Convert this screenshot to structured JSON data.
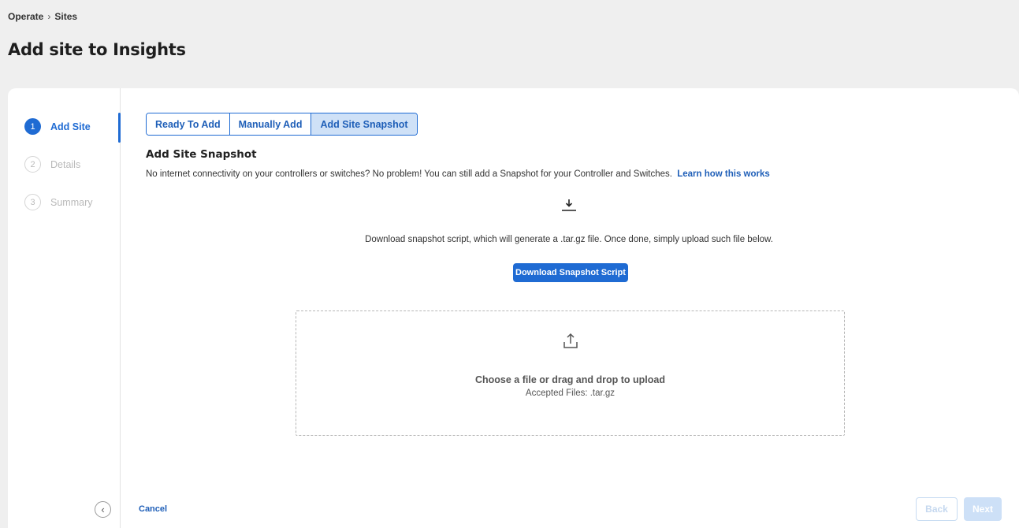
{
  "breadcrumb": {
    "parent": "Operate",
    "separator": "›",
    "current": "Sites"
  },
  "page": {
    "title": "Add site to Insights"
  },
  "steps": [
    {
      "number": "1",
      "label": "Add Site",
      "state": "active"
    },
    {
      "number": "2",
      "label": "Details",
      "state": "inactive"
    },
    {
      "number": "3",
      "label": "Summary",
      "state": "inactive"
    }
  ],
  "sidebar": {
    "collapse_icon": "chevron-left-icon",
    "collapse_glyph": "‹"
  },
  "tabs": [
    {
      "label": "Ready To Add",
      "selected": false
    },
    {
      "label": "Manually Add",
      "selected": false
    },
    {
      "label": "Add Site Snapshot",
      "selected": true
    }
  ],
  "snapshot": {
    "title": "Add Site Snapshot",
    "intro": "No internet connectivity on your controllers or switches? No problem! You can still add a Snapshot for your Controller and Switches.",
    "learn_link": "Learn how this works",
    "download_icon": "download-icon",
    "download_text": "Download snapshot script, which will generate a .tar.gz file. Once done, simply upload such file below.",
    "download_button": "Download Snapshot Script"
  },
  "dropzone": {
    "icon": "upload-icon",
    "title": "Choose a file or drag and drop to upload",
    "accepted": "Accepted Files: .tar.gz"
  },
  "footer": {
    "cancel": "Cancel",
    "back": "Back",
    "next": "Next"
  },
  "colors": {
    "accent": "#1f6bd3",
    "background": "#efefef",
    "disabled": "#cde0f7"
  }
}
